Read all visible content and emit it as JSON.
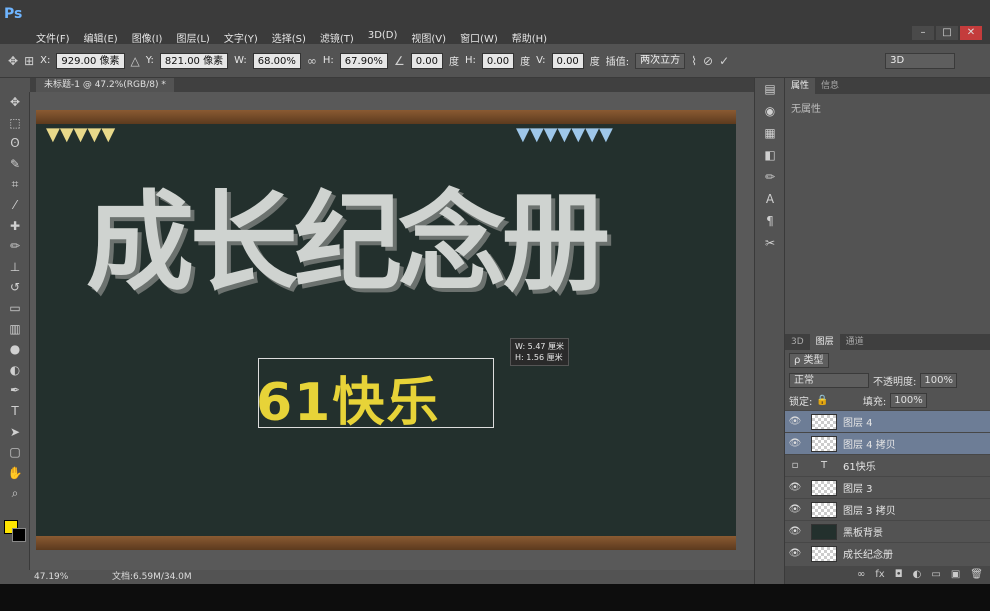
{
  "app": {
    "logo": "Ps"
  },
  "menu": [
    "文件(F)",
    "编辑(E)",
    "图像(I)",
    "图层(L)",
    "文字(Y)",
    "选择(S)",
    "滤镜(T)",
    "3D(D)",
    "视图(V)",
    "窗口(W)",
    "帮助(H)"
  ],
  "window_controls": {
    "minimize": "–",
    "restore": "□",
    "close": "✕"
  },
  "options": {
    "x_label": "X:",
    "x_value": "929.00 像素",
    "y_label": "Y:",
    "y_value": "821.00 像素",
    "w_label": "W:",
    "w_value": "68.00%",
    "h_label": "H:",
    "h_value": "67.90%",
    "angle_value": "0.00",
    "angle_unit": "度",
    "hskew_label": "H:",
    "hskew_value": "0.00",
    "hskew_unit": "度",
    "vskew_label": "V:",
    "vskew_value": "0.00",
    "vskew_unit": "度",
    "interp_label": "插值:",
    "interp_value": "两次立方",
    "workspace": "3D"
  },
  "document": {
    "tab_title": "未标题-1 @ 47.2%(RGB/8) *"
  },
  "canvas": {
    "title_art": "成长纪念册",
    "sub_art": "61快乐",
    "transform_tip_w": "W:  5.47 厘米",
    "transform_tip_h": "H:  1.56 厘米"
  },
  "status": {
    "zoom": "47.19%",
    "doc": "文档:6.59M/34.0M"
  },
  "properties": {
    "tab_properties": "属性",
    "tab_info": "信息",
    "body": "无属性"
  },
  "layers_panel": {
    "tab_3d": "3D",
    "tab_layers": "图层",
    "tab_channels": "通道",
    "filter_label": "ρ 类型",
    "blend_mode": "正常",
    "opacity_label": "不透明度:",
    "opacity_value": "100%",
    "lock_label": "锁定:",
    "fill_label": "填充:",
    "fill_value": "100%",
    "layers": [
      {
        "name": "图层 4",
        "selected": true,
        "visible": true,
        "kind": "pixel"
      },
      {
        "name": "图层 4 拷贝",
        "selected": true,
        "visible": true,
        "kind": "pixel"
      },
      {
        "name": "61快乐",
        "selected": false,
        "visible": false,
        "kind": "text"
      },
      {
        "name": "图层 3",
        "selected": false,
        "visible": true,
        "kind": "pixel"
      },
      {
        "name": "图层 3 拷贝",
        "selected": false,
        "visible": true,
        "kind": "pixel"
      },
      {
        "name": "黑板背景",
        "selected": false,
        "visible": true,
        "kind": "dark"
      },
      {
        "name": "成长纪念册",
        "selected": false,
        "visible": true,
        "kind": "pixel"
      }
    ]
  },
  "colors": {
    "foreground": "#ffe500",
    "background": "#000000",
    "selection": "#6d7d96",
    "board": "#23302d"
  }
}
